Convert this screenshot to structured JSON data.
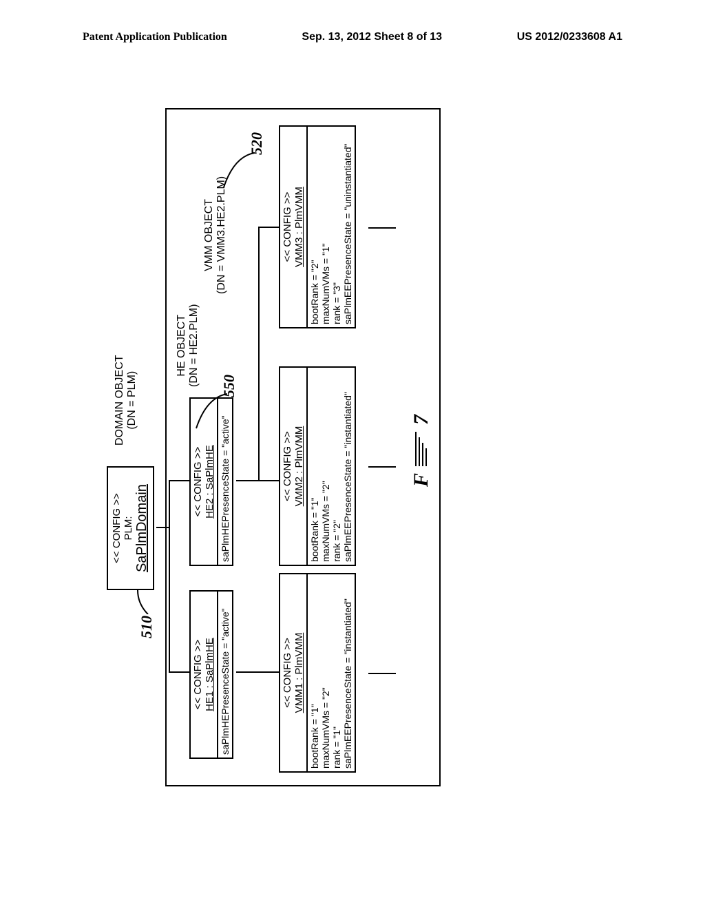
{
  "header": {
    "left": "Patent Application Publication",
    "center": "Sep. 13, 2012  Sheet 8 of 13",
    "right": "US 2012/0233608 A1"
  },
  "domain": {
    "stereotype": "<< CONFIG >>",
    "name_line1": "PLM:",
    "name_line2": "SaPlmDomain",
    "object_label_line1": "DOMAIN OBJECT",
    "object_label_line2": "(DN = PLM)"
  },
  "he1": {
    "stereotype": "<< CONFIG >>",
    "name": "HE1 : SaPlmHE",
    "state": "saPlmHEPresenceState = \"active\""
  },
  "he2": {
    "stereotype": "<< CONFIG >>",
    "name": "HE2 : SaPlmHE",
    "state": "saPlmHEPresenceState = \"active\"",
    "object_label_line1": "HE OBJECT",
    "object_label_line2": "(DN = HE2.PLM)"
  },
  "vmm1": {
    "stereotype": "<< CONFIG >>",
    "name": "VMM1 : PlmVMM",
    "bootRank": "bootRank = \"1\"",
    "maxNumVMs": "maxNumVMs = \"2\"",
    "rank": "rank = \"1\"",
    "state": "saPlmEEPresenceState = \"instantiated\""
  },
  "vmm2": {
    "stereotype": "<< CONFIG >>",
    "name": "VMM2 : PlmVMM",
    "bootRank": "bootRank = \"1\"",
    "maxNumVMs": "maxNumVMs = \"2\"",
    "rank": "rank = \"2\"",
    "state": "saPlmEEPresenceState = \"instantiated\""
  },
  "vmm3": {
    "stereotype": "<< CONFIG >>",
    "name": "VMM3 : PlmVMM",
    "bootRank": "bootRank = \"2\"",
    "maxNumVMs": "maxNumVMs = \"1\"",
    "rank": "rank = \"3\"",
    "state": "saPlmEEPresenceState = \"uninstantiated\"",
    "object_label_line1": "VMM OBJECT",
    "object_label_line2": "(DN = VMM3.HE2.PLM)"
  },
  "refs": {
    "r510": "510",
    "r550": "550",
    "r520": "520"
  },
  "figure": {
    "prefix": "F",
    "suffix": "7"
  }
}
